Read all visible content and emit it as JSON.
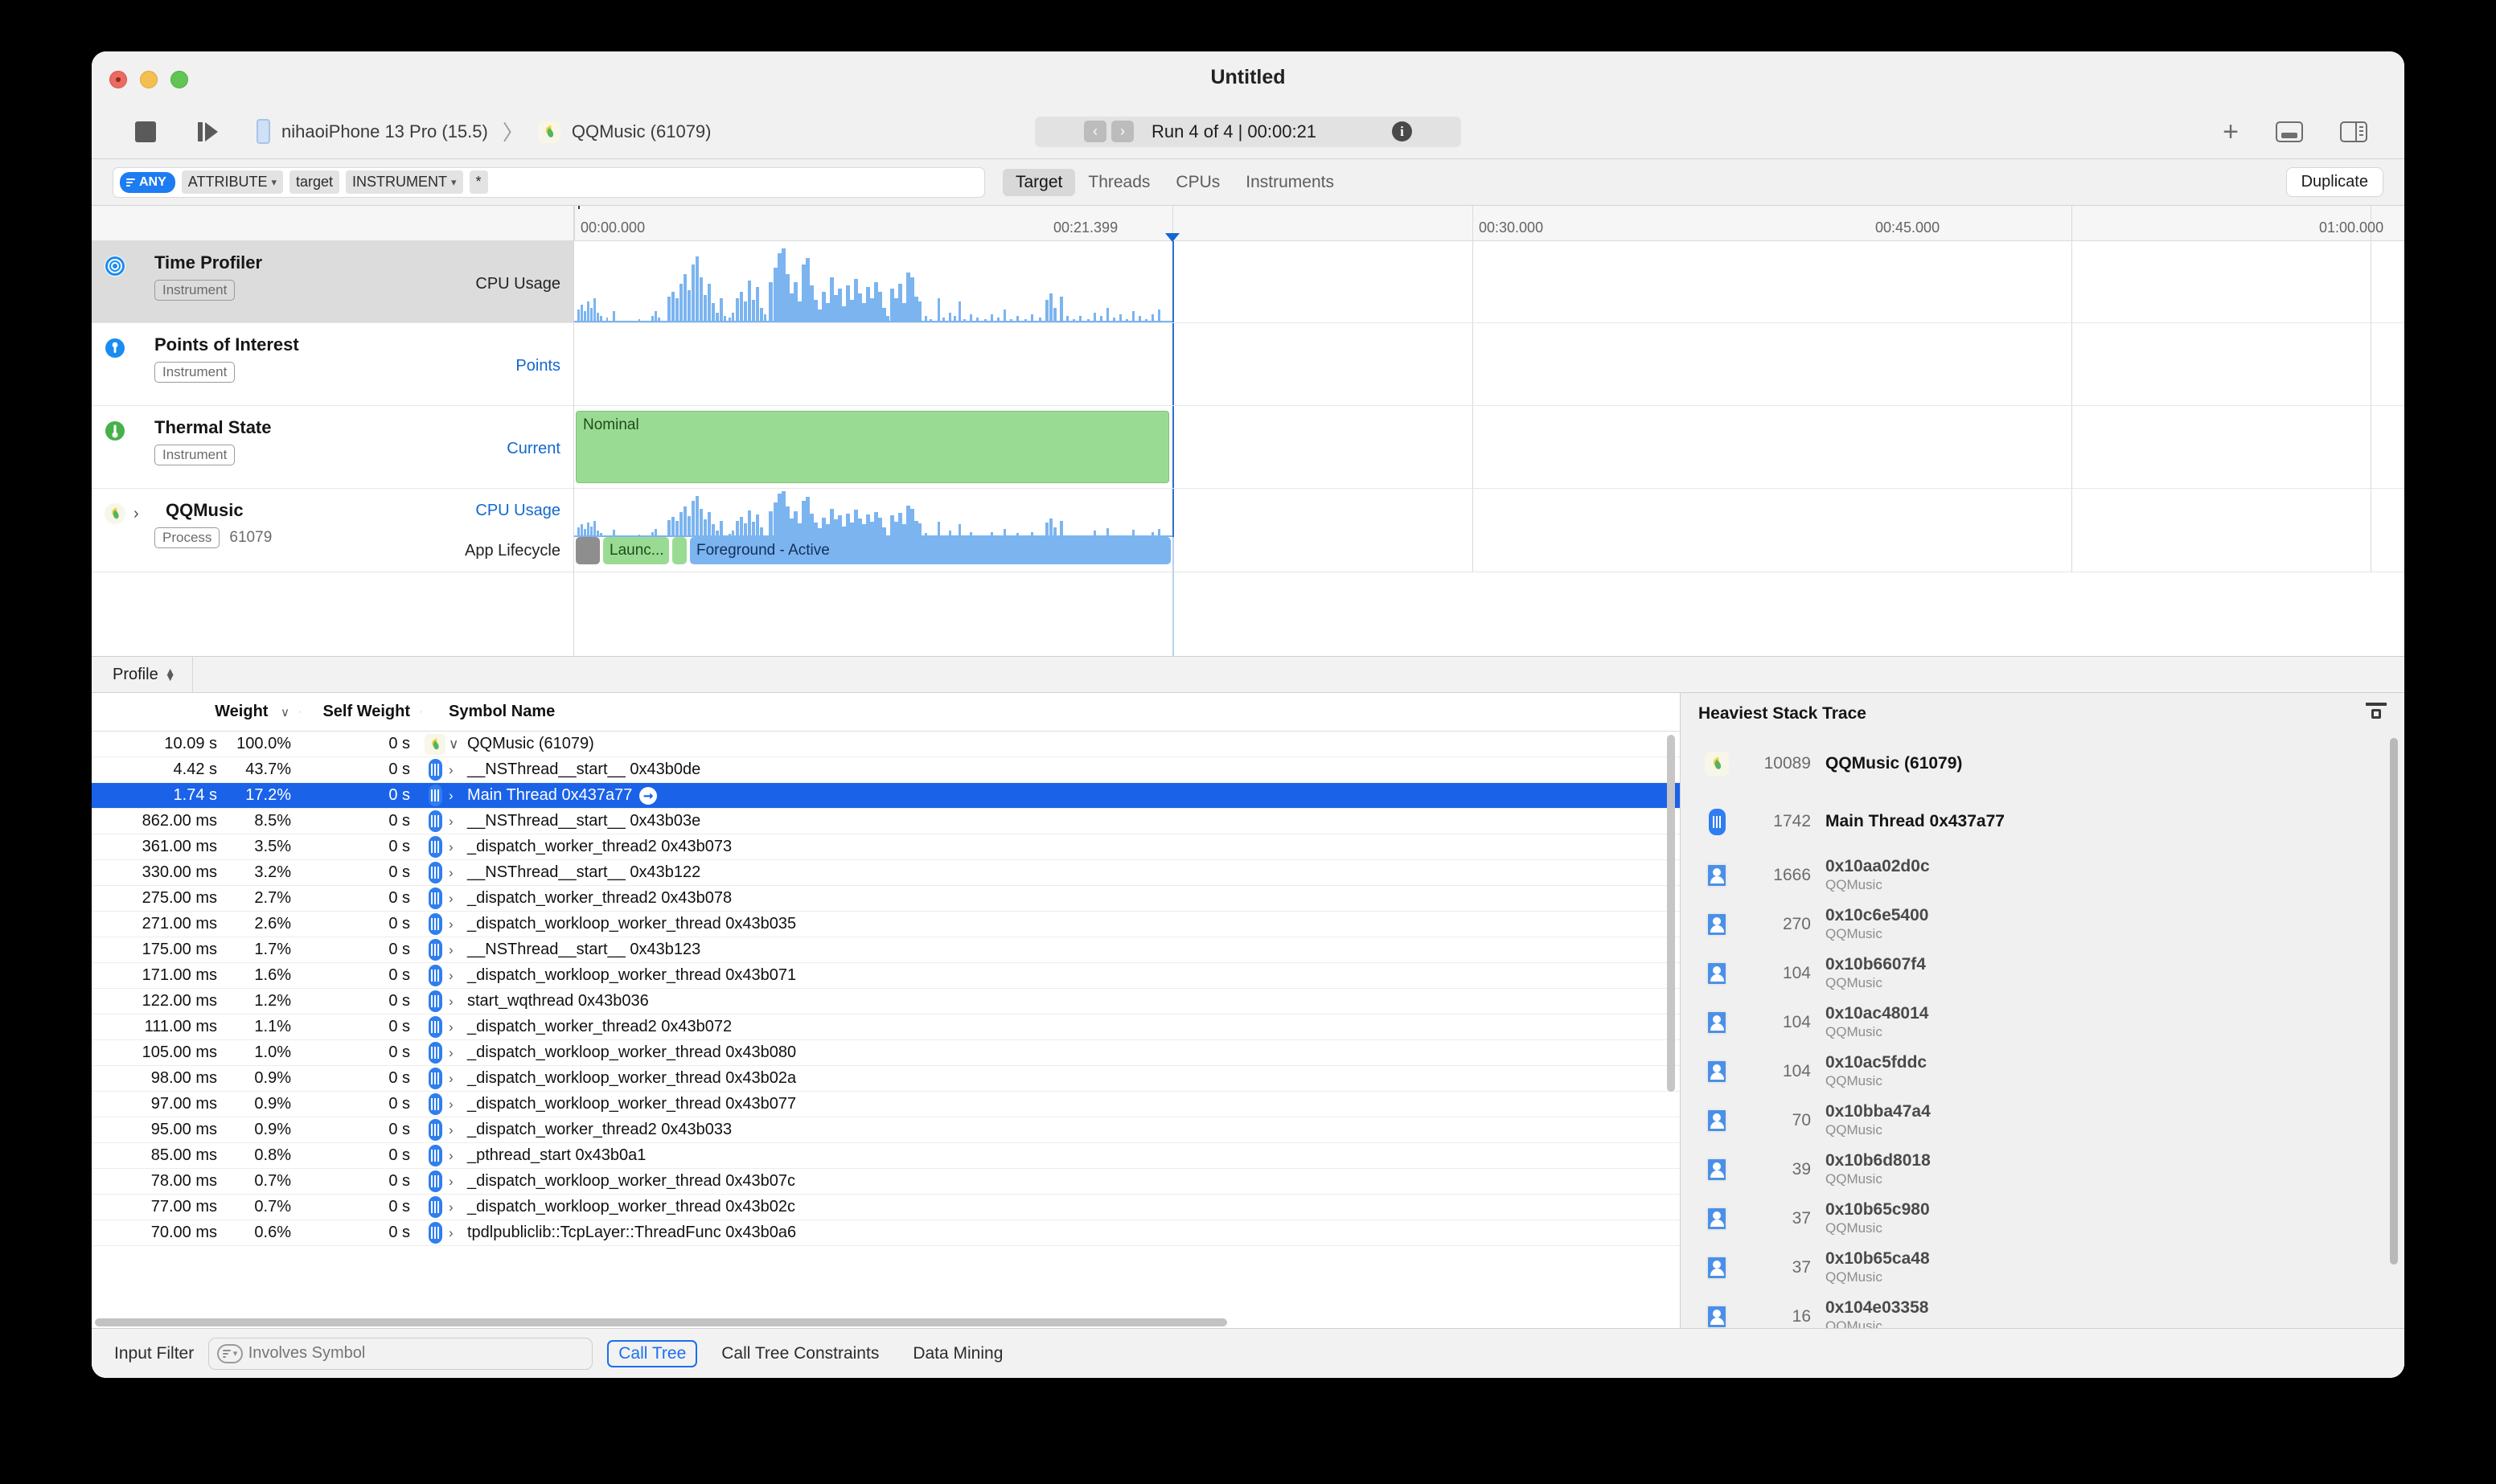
{
  "window": {
    "title": "Untitled"
  },
  "toolbar": {
    "stop_label": "Stop",
    "record_label": "Record",
    "device": "nihaoiPhone 13 Pro (15.5)",
    "separator": "〉",
    "process": "QQMusic (61079)",
    "run_text": "Run 4 of 4  |  00:00:21",
    "prev_label": "‹",
    "next_label": "›",
    "info_label": "i",
    "add_label": "+"
  },
  "filterbar": {
    "any_pill": "ANY",
    "token_attribute": "ATTRIBUTE",
    "token_target": "target",
    "token_instrument": "INSTRUMENT",
    "token_star": "*",
    "tabs": [
      "Target",
      "Threads",
      "CPUs",
      "Instruments"
    ],
    "active_tab": "Target",
    "duplicate": "Duplicate"
  },
  "timeline": {
    "ticks": [
      "00:00.000",
      "00:21.399",
      "00:30.000",
      "00:45.000",
      "01:00.000"
    ],
    "tracks": [
      {
        "title": "Time Profiler",
        "badge": "Instrument",
        "lane": "CPU Usage",
        "lane_style": "dark",
        "selected": true,
        "icon": "time-profiler-icon"
      },
      {
        "title": "Points of Interest",
        "badge": "Instrument",
        "lane": "Points",
        "lane_style": "blue",
        "selected": false,
        "icon": "points-of-interest-icon"
      },
      {
        "title": "Thermal State",
        "badge": "Instrument",
        "lane": "Current",
        "lane_style": "blue",
        "selected": false,
        "icon": "thermal-state-icon",
        "band_label": "Nominal"
      },
      {
        "title": "QQMusic",
        "badge": "Process",
        "pid": "61079",
        "lane": "CPU Usage",
        "lane_style": "blue",
        "lane2": "App Lifecycle",
        "lane2_style": "dark",
        "selected": false,
        "icon": "qqmusic-icon"
      }
    ],
    "lifecycle": [
      {
        "label": "",
        "color": "#8e8e8e",
        "text_color": "#3a3a3a"
      },
      {
        "label": "Launc...",
        "color": "#9adb93",
        "text_color": "#1d4c1a"
      },
      {
        "label": "",
        "color": "#9adb93",
        "text_color": "#1d4c1a"
      },
      {
        "label": "Foreground - Active",
        "color": "#7cb4f0",
        "text_color": "#10305c"
      }
    ]
  },
  "detail": {
    "jump_label": "Profile",
    "columns": [
      "Weight",
      "Self Weight",
      "Symbol Name"
    ],
    "sort_caret": "∨",
    "rows": [
      {
        "weight": "10.09 s",
        "pct": "100.0%",
        "self": "0 s",
        "icon": "qqmusic-icon",
        "caret": "∨",
        "symbol": "QQMusic (61079)",
        "selected": false,
        "root": true
      },
      {
        "weight": "4.42 s",
        "pct": "43.7%",
        "self": "0 s",
        "icon": "thread-icon",
        "caret": "›",
        "symbol": "__NSThread__start__  0x43b0de",
        "selected": false
      },
      {
        "weight": "1.74 s",
        "pct": "17.2%",
        "self": "0 s",
        "icon": "thread-icon",
        "caret": "›",
        "symbol": "Main Thread  0x437a77",
        "selected": true,
        "goto": true
      },
      {
        "weight": "862.00 ms",
        "pct": "8.5%",
        "self": "0 s",
        "icon": "thread-icon",
        "caret": "›",
        "symbol": "__NSThread__start__  0x43b03e",
        "selected": false
      },
      {
        "weight": "361.00 ms",
        "pct": "3.5%",
        "self": "0 s",
        "icon": "thread-icon",
        "caret": "›",
        "symbol": "_dispatch_worker_thread2  0x43b073",
        "selected": false
      },
      {
        "weight": "330.00 ms",
        "pct": "3.2%",
        "self": "0 s",
        "icon": "thread-icon",
        "caret": "›",
        "symbol": "__NSThread__start__  0x43b122",
        "selected": false
      },
      {
        "weight": "275.00 ms",
        "pct": "2.7%",
        "self": "0 s",
        "icon": "thread-icon",
        "caret": "›",
        "symbol": "_dispatch_worker_thread2  0x43b078",
        "selected": false
      },
      {
        "weight": "271.00 ms",
        "pct": "2.6%",
        "self": "0 s",
        "icon": "thread-icon",
        "caret": "›",
        "symbol": "_dispatch_workloop_worker_thread  0x43b035",
        "selected": false
      },
      {
        "weight": "175.00 ms",
        "pct": "1.7%",
        "self": "0 s",
        "icon": "thread-icon",
        "caret": "›",
        "symbol": "__NSThread__start__  0x43b123",
        "selected": false
      },
      {
        "weight": "171.00 ms",
        "pct": "1.6%",
        "self": "0 s",
        "icon": "thread-icon",
        "caret": "›",
        "symbol": "_dispatch_workloop_worker_thread  0x43b071",
        "selected": false
      },
      {
        "weight": "122.00 ms",
        "pct": "1.2%",
        "self": "0 s",
        "icon": "thread-icon",
        "caret": "›",
        "symbol": "start_wqthread  0x43b036",
        "selected": false
      },
      {
        "weight": "111.00 ms",
        "pct": "1.1%",
        "self": "0 s",
        "icon": "thread-icon",
        "caret": "›",
        "symbol": "_dispatch_worker_thread2  0x43b072",
        "selected": false
      },
      {
        "weight": "105.00 ms",
        "pct": "1.0%",
        "self": "0 s",
        "icon": "thread-icon",
        "caret": "›",
        "symbol": "_dispatch_workloop_worker_thread  0x43b080",
        "selected": false
      },
      {
        "weight": "98.00 ms",
        "pct": "0.9%",
        "self": "0 s",
        "icon": "thread-icon",
        "caret": "›",
        "symbol": "_dispatch_workloop_worker_thread  0x43b02a",
        "selected": false
      },
      {
        "weight": "97.00 ms",
        "pct": "0.9%",
        "self": "0 s",
        "icon": "thread-icon",
        "caret": "›",
        "symbol": "_dispatch_workloop_worker_thread  0x43b077",
        "selected": false
      },
      {
        "weight": "95.00 ms",
        "pct": "0.9%",
        "self": "0 s",
        "icon": "thread-icon",
        "caret": "›",
        "symbol": "_dispatch_worker_thread2  0x43b033",
        "selected": false
      },
      {
        "weight": "85.00 ms",
        "pct": "0.8%",
        "self": "0 s",
        "icon": "thread-icon",
        "caret": "›",
        "symbol": "_pthread_start  0x43b0a1",
        "selected": false
      },
      {
        "weight": "78.00 ms",
        "pct": "0.7%",
        "self": "0 s",
        "icon": "thread-icon",
        "caret": "›",
        "symbol": "_dispatch_workloop_worker_thread  0x43b07c",
        "selected": false
      },
      {
        "weight": "77.00 ms",
        "pct": "0.7%",
        "self": "0 s",
        "icon": "thread-icon",
        "caret": "›",
        "symbol": "_dispatch_workloop_worker_thread  0x43b02c",
        "selected": false
      },
      {
        "weight": "70.00 ms",
        "pct": "0.6%",
        "self": "0 s",
        "icon": "thread-icon",
        "caret": "›",
        "symbol": "tpdlpubliclib::TcpLayer::ThreadFunc  0x43b0a6",
        "selected": false
      }
    ]
  },
  "heaviest": {
    "title": "Heaviest Stack Trace",
    "rows": [
      {
        "count": "10089",
        "name": "QQMusic (61079)",
        "sub": "",
        "icon": "qqmusic-icon",
        "dark": true
      },
      {
        "count": "1742",
        "name": "Main Thread  0x437a77",
        "sub": "",
        "icon": "thread-icon",
        "dark": true
      },
      {
        "count": "1666",
        "name": "0x10aa02d0c",
        "sub": "QQMusic",
        "icon": "symbol-icon",
        "dark": false
      },
      {
        "count": "270",
        "name": "0x10c6e5400",
        "sub": "QQMusic",
        "icon": "symbol-icon",
        "dark": false
      },
      {
        "count": "104",
        "name": "0x10b6607f4",
        "sub": "QQMusic",
        "icon": "symbol-icon",
        "dark": false
      },
      {
        "count": "104",
        "name": "0x10ac48014",
        "sub": "QQMusic",
        "icon": "symbol-icon",
        "dark": false
      },
      {
        "count": "104",
        "name": "0x10ac5fddc",
        "sub": "QQMusic",
        "icon": "symbol-icon",
        "dark": false
      },
      {
        "count": "70",
        "name": "0x10bba47a4",
        "sub": "QQMusic",
        "icon": "symbol-icon",
        "dark": false
      },
      {
        "count": "39",
        "name": "0x10b6d8018",
        "sub": "QQMusic",
        "icon": "symbol-icon",
        "dark": false
      },
      {
        "count": "37",
        "name": "0x10b65c980",
        "sub": "QQMusic",
        "icon": "symbol-icon",
        "dark": false
      },
      {
        "count": "37",
        "name": "0x10b65ca48",
        "sub": "QQMusic",
        "icon": "symbol-icon",
        "dark": false
      },
      {
        "count": "16",
        "name": "0x104e03358",
        "sub": "QQMusic",
        "icon": "symbol-icon",
        "dark": false
      }
    ]
  },
  "bottombar": {
    "input_filter_label": "Input Filter",
    "search_placeholder": "Involves Symbol",
    "search_value": "",
    "call_tree": "Call Tree",
    "call_tree_constraints": "Call Tree Constraints",
    "data_mining": "Data Mining"
  },
  "colors": {
    "accent": "#1a62e8",
    "cpu_graph": "#7cb4f0",
    "nominal": "#9adb93",
    "playhead": "#2c6fd1"
  }
}
